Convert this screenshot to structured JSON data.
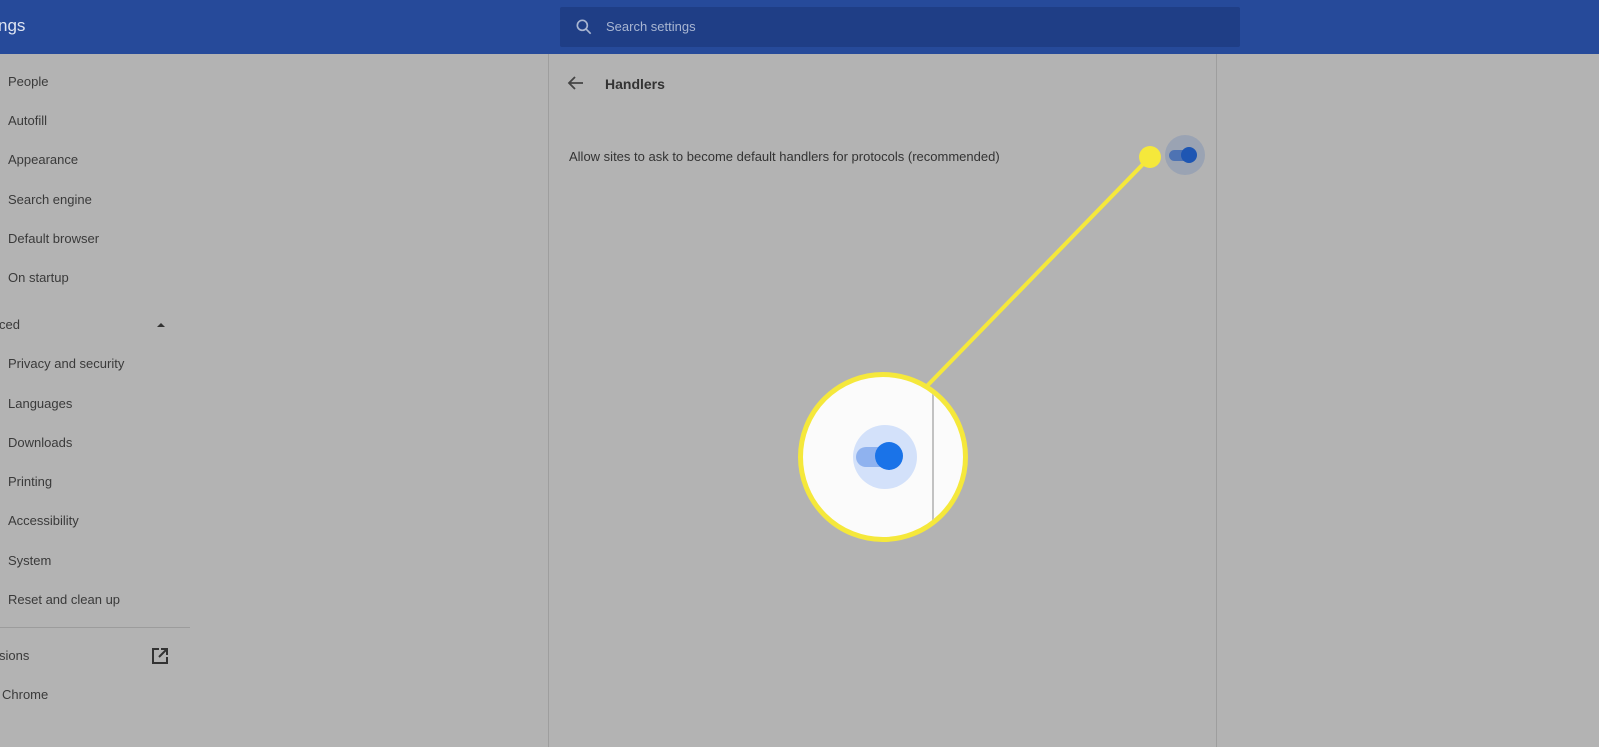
{
  "header": {
    "title": "ngs",
    "search_placeholder": "Search settings"
  },
  "sidebar": {
    "items": [
      {
        "label": "People"
      },
      {
        "label": "Autofill"
      },
      {
        "label": "Appearance"
      },
      {
        "label": "Search engine"
      },
      {
        "label": "Default browser"
      },
      {
        "label": "On startup"
      }
    ],
    "advanced": {
      "label": "ced"
    },
    "advanced_items": [
      {
        "label": "Privacy and security"
      },
      {
        "label": "Languages"
      },
      {
        "label": "Downloads"
      },
      {
        "label": "Printing"
      },
      {
        "label": "Accessibility"
      },
      {
        "label": "System"
      },
      {
        "label": "Reset and clean up"
      }
    ],
    "extensions": {
      "label": "sions"
    },
    "about": {
      "label": "Chrome"
    }
  },
  "panel": {
    "title": "Handlers",
    "setting_label": "Allow sites to ask to become default handlers for protocols (recommended)",
    "setting_enabled": true
  },
  "colors": {
    "header": "#264a9a",
    "highlight": "#f5e83b",
    "toggle_on": "#1a73e8"
  }
}
